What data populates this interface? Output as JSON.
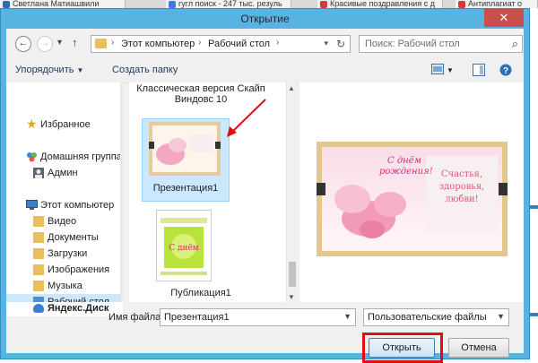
{
  "browser_tabs": [
    {
      "label": "Светлана Матиашвили",
      "fav": "#2b6cb0"
    },
    {
      "label": "гугл поиск - 247 тыс. резуль",
      "fav": "#3a7be0"
    },
    {
      "label": "Красивые поздравления с д",
      "fav": "#d43a3a"
    },
    {
      "label": "Антиплагиат о",
      "fav": "#d43a3a"
    }
  ],
  "dialog": {
    "title": "Открытие",
    "close_glyph": "✕"
  },
  "nav": {
    "breadcrumb": [
      "Этот компьютер",
      "Рабочий стол"
    ],
    "search_placeholder": "Поиск: Рабочий стол"
  },
  "toolbar": {
    "organize": "Упорядочить",
    "new_folder": "Создать папку"
  },
  "sidebar": {
    "items": [
      {
        "label": "Избранное",
        "icon": "star-icon"
      },
      {
        "label": "Домашняя группа",
        "icon": "homegroup-icon"
      },
      {
        "label": "Админ",
        "icon": "user-icon"
      },
      {
        "label": "Этот компьютер",
        "icon": "computer-icon"
      },
      {
        "label": "Видео",
        "icon": "video-folder-icon"
      },
      {
        "label": "Документы",
        "icon": "documents-folder-icon"
      },
      {
        "label": "Загрузки",
        "icon": "downloads-folder-icon"
      },
      {
        "label": "Изображения",
        "icon": "pictures-folder-icon"
      },
      {
        "label": "Музыка",
        "icon": "music-folder-icon"
      },
      {
        "label": "Рабочий стол",
        "icon": "desktop-folder-icon"
      },
      {
        "label": "Яндекс.Диск",
        "icon": "yandex-disk-icon"
      }
    ]
  },
  "files": [
    {
      "label": "Классическая версия Скайп Виндовс 10"
    },
    {
      "label": "Презентация1"
    },
    {
      "label": "Публикация1"
    }
  ],
  "preview": {
    "card_left_text": "С днём рождения!",
    "card_right_text": "Счастья, здоровья, любви!"
  },
  "bottom": {
    "filename_label": "Имя файла:",
    "filename_value": "Презентация1",
    "filetype_value": "Пользовательские файлы",
    "open_label": "Открыть",
    "cancel_label": "Отмена"
  },
  "colors": {
    "title_bar": "#58b3e3",
    "close_button": "#c7504c",
    "selection": "#cce8ff",
    "highlight": "#e10c12"
  }
}
